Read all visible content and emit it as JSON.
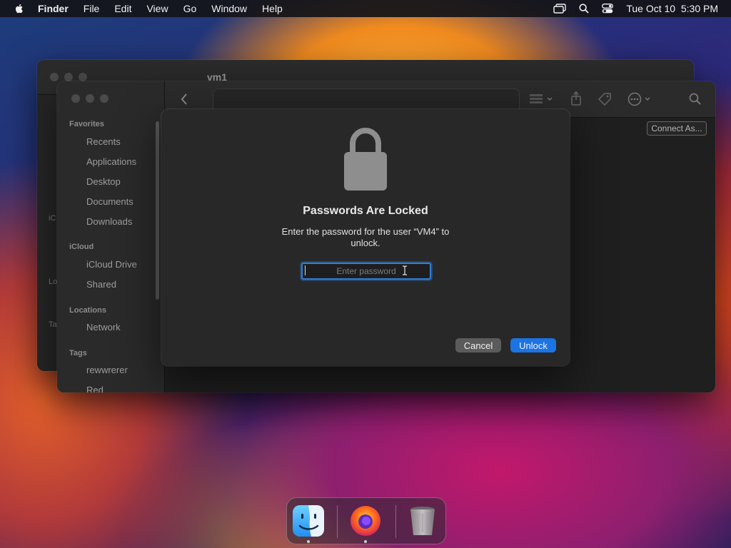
{
  "menubar": {
    "app_name": "Finder",
    "items": [
      "File",
      "Edit",
      "View",
      "Go",
      "Window",
      "Help"
    ],
    "clock": "Tue Oct 10  5:30 PM"
  },
  "back_window": {
    "title": "vm1",
    "sidebar_fragments": [
      "iC",
      "Lo",
      "Ta"
    ]
  },
  "finder": {
    "sidebar": {
      "favorites_header": "Favorites",
      "favorites": [
        "Recents",
        "Applications",
        "Desktop",
        "Documents",
        "Downloads"
      ],
      "icloud_header": "iCloud",
      "icloud": [
        "iCloud Drive",
        "Shared"
      ],
      "locations_header": "Locations",
      "locations": [
        "Network"
      ],
      "tags_header": "Tags",
      "tags": [
        "rewwrerer",
        "Red"
      ]
    },
    "connect_button": "Connect As..."
  },
  "dialog": {
    "title": "Passwords Are Locked",
    "message": "Enter the password for the user “VM4” to unlock.",
    "password_placeholder": "Enter password",
    "password_value": "",
    "cancel_label": "Cancel",
    "unlock_label": "Unlock",
    "accent_color": "#1b74e4"
  },
  "dock": {
    "apps": [
      "finder-icon",
      "firefox-icon",
      "trash-icon"
    ]
  }
}
